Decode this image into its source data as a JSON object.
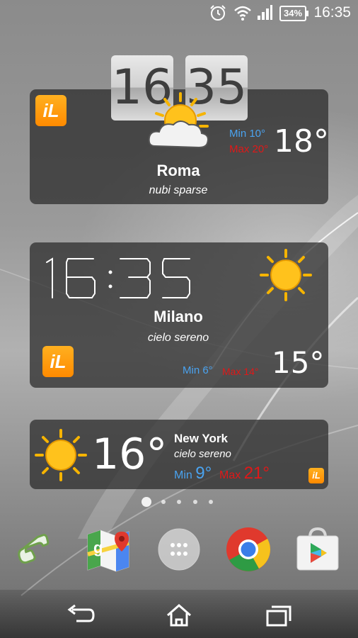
{
  "status_bar": {
    "time": "16:35",
    "battery": "34%",
    "icons": [
      "alarm-icon",
      "wifi-icon",
      "signal-icon",
      "battery-icon"
    ]
  },
  "widget_roma": {
    "clock_hour": "16",
    "clock_minute": "35",
    "city": "Roma",
    "condition": "nubi sparse",
    "min": "Min 10°",
    "max": "Max 20°",
    "temp": "18°",
    "icon": "partly-cloudy-icon"
  },
  "widget_milano": {
    "clock": "16:35",
    "city": "Milano",
    "condition": "cielo sereno",
    "min": "Min 6°",
    "max": "Max 14°",
    "temp": "15°",
    "icon": "sun-icon"
  },
  "widget_newyork": {
    "temp": "16°",
    "city": "New York",
    "condition": "cielo sereno",
    "min_label": "Min",
    "min_value": "9°",
    "max_label": "Max",
    "max_value": "21°",
    "icon": "sun-icon"
  },
  "app_logo": "iL",
  "home_pages": {
    "count": 5,
    "active": 0
  },
  "dock": [
    {
      "name": "phone",
      "icon": "phone-icon"
    },
    {
      "name": "maps",
      "icon": "maps-icon"
    },
    {
      "name": "app-drawer",
      "icon": "app-drawer-icon"
    },
    {
      "name": "chrome",
      "icon": "chrome-icon"
    },
    {
      "name": "play-store",
      "icon": "play-store-icon"
    }
  ],
  "nav": [
    "back-icon",
    "home-icon",
    "recent-apps-icon"
  ],
  "colors": {
    "min": "#4aa3f0",
    "max": "#e01818",
    "logo": "#ff9a10",
    "card": "#2a2a2a"
  }
}
